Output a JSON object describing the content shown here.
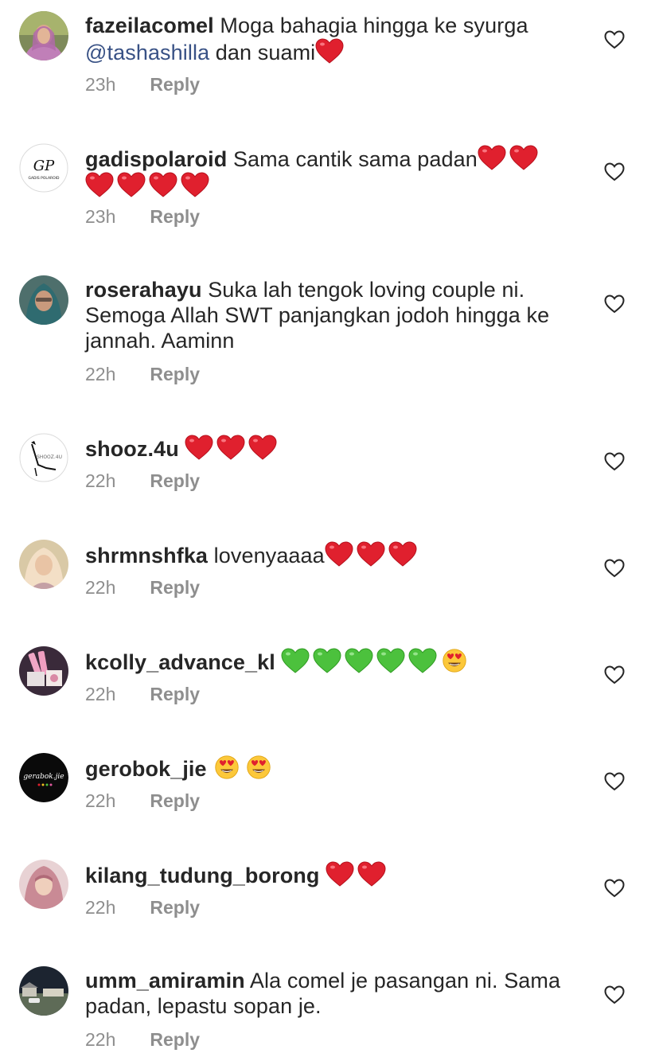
{
  "comments": [
    {
      "username": "fazeilacomel",
      "text_before": "Moga bahagia hingga ke syurga",
      "mention": "@tashashilla",
      "text_after": "dan suami",
      "time": "23h",
      "reply": "Reply",
      "avatar_icon": "profile-photo"
    },
    {
      "username": "gadispolaroid",
      "text": "Sama cantik sama padan",
      "time": "23h",
      "reply": "Reply",
      "avatar_text": "GP",
      "avatar_subtext": "GADIS POLAROID"
    },
    {
      "username": "roserahayu",
      "text": "Suka lah tengok loving couple ni. Semoga Allah SWT panjangkan jodoh hingga ke jannah. Aaminn",
      "time": "22h",
      "reply": "Reply"
    },
    {
      "username": "shooz.4u",
      "time": "22h",
      "reply": "Reply",
      "avatar_text": "SHOOZ.4U"
    },
    {
      "username": "shrmnshfka",
      "text": "lovenyaaaa",
      "time": "22h",
      "reply": "Reply"
    },
    {
      "username": "kcolly_advance_kl",
      "time": "22h",
      "reply": "Reply"
    },
    {
      "username": "gerobok_jie",
      "time": "22h",
      "reply": "Reply",
      "avatar_text": "gerabok.jie"
    },
    {
      "username": "kilang_tudung_borong",
      "time": "22h",
      "reply": "Reply"
    },
    {
      "username": "umm_amiramin",
      "text": "Ala comel je pasangan ni. Sama padan, lepastu sopan je.",
      "time": "22h",
      "reply": "Reply"
    }
  ],
  "colors": {
    "username": "#262626",
    "mention": "#385185",
    "meta": "#8e8e8e",
    "red_heart": "#e0202e",
    "green_heart": "#4cc13d"
  }
}
